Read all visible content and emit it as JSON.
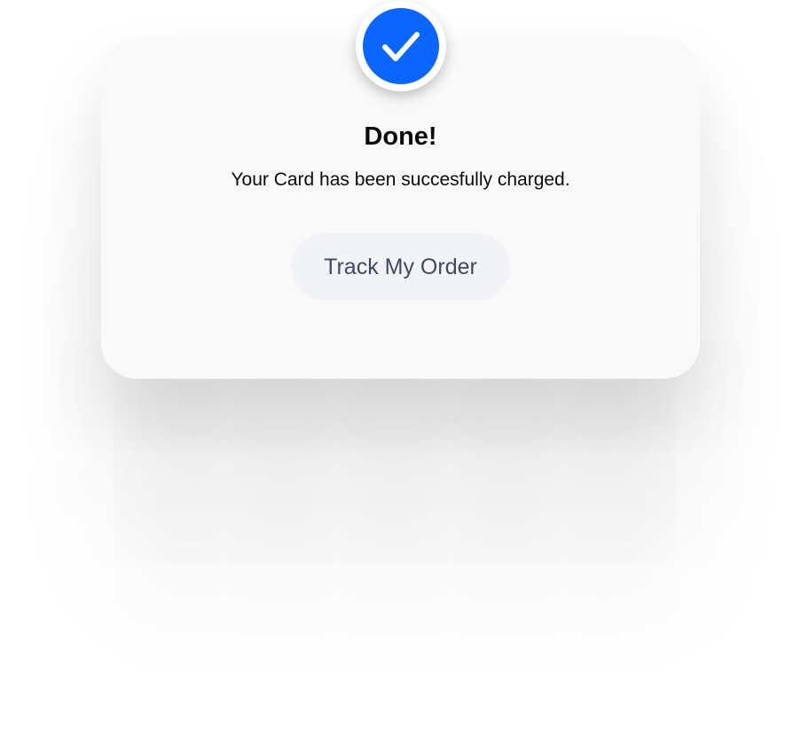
{
  "dialog": {
    "icon": "checkmark-icon",
    "title": "Done!",
    "message": "Your Card has been succesfully charged.",
    "button_label": "Track My Order"
  },
  "colors": {
    "accent": "#0b66ff",
    "card_background": "#f9f9fa",
    "button_background": "#f1f3f7",
    "button_text": "#3f4a5e",
    "text": "#0b0b0b"
  }
}
